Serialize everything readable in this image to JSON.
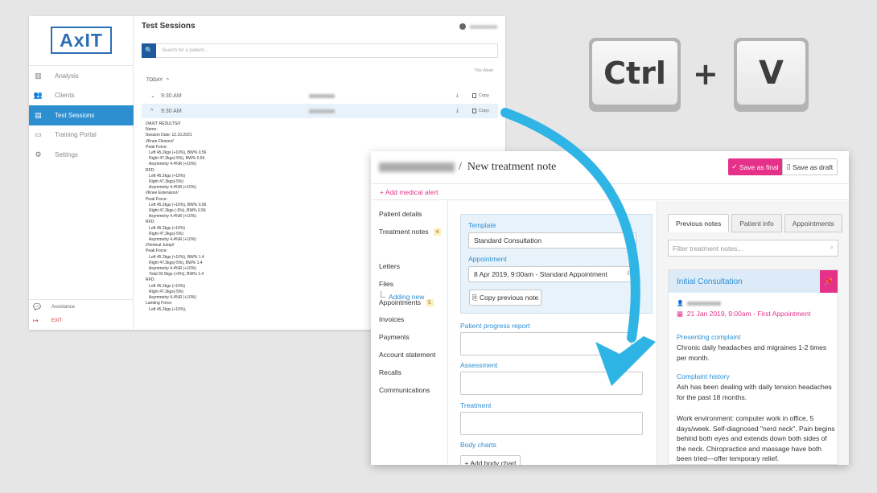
{
  "axit": {
    "logo": "AxIT",
    "nav": [
      {
        "label": "Analysis",
        "icon": "bar-chart-icon"
      },
      {
        "label": "Clients",
        "icon": "users-icon"
      },
      {
        "label": "Test Sessions",
        "icon": "document-icon",
        "active": true
      },
      {
        "label": "Training Portal",
        "icon": "monitor-icon"
      },
      {
        "label": "Settings",
        "icon": "gear-icon"
      }
    ],
    "assistance": "Assistance",
    "exit": "EXIT",
    "title": "Test Sessions",
    "search_placeholder": "Search for a patient...",
    "this_week": "This Week",
    "today": "TODAY",
    "sessions": [
      {
        "time": "9:30 AM",
        "copy": "Copy"
      },
      {
        "time": "9:30 AM",
        "copy": "Copy"
      }
    ],
    "results_text": "///AXIT RESULTS///\nName:\nSession Date: 12.10.2021\n//Knee Flexion//\nPeak Force:\n   Left 45.2kgs (+10%), BW% 0.56\n   Right 47.3kgs(-5%), BW% 0.56\n   Asymmetry 4.4%R (+10%)\nRFD:\n   Left 45.2kgs (+10%)\n   Right 47.3kgs(-5%)\n   Asymmetry 4.4%R (+10%)\n//Knee Extension//\nPeak Force:\n   Left 45.2kgs (+10%), BW% 0.56\n   Right 47.3kgs (-5%), BW% 0.56\n   Asymmetry 4.4%R (+10%)\nRFD:\n   Left 45.2kgs (+10%)\n   Right 47.3kgs(-5%)\n   Asymmetry 4.4%R (+10%)\n//Vertical Jump//\nPeak Force:\n   Left 45.2kgs (+10%), BW% 1.4\n   Right 47.3kgs(-5%), BW% 1.4\n   Asymmetry 4.4%R (+10%)\n   Total 92.5kgs (+5%), BW% 1.4\nRFD:\n   Left 45.2kgs (+10%)\n   Right 47.3kgs(-5%)\n   Asymmetry 4.4%R (+10%)\nLanding Force:\n   Left 45.2kgs (+10%),"
  },
  "keys": {
    "ctrl": "Ctrl",
    "plus": "+",
    "v": "V"
  },
  "note": {
    "separator": "/",
    "title": "New treatment note",
    "save_final": "Save as final",
    "save_draft": "Save as draft",
    "add_alert": "+ Add medical alert",
    "sidebar": [
      {
        "label": "Patient details"
      },
      {
        "label": "Treatment notes",
        "count": "4"
      },
      {
        "label": "Letters"
      },
      {
        "label": "Files"
      },
      {
        "label": "Appointments",
        "count": "5"
      },
      {
        "label": "Invoices"
      },
      {
        "label": "Payments"
      },
      {
        "label": "Account statement"
      },
      {
        "label": "Recalls"
      },
      {
        "label": "Communications"
      }
    ],
    "adding_new": "Adding new",
    "template_label": "Template",
    "template_value": "Standard Consultation",
    "appointment_label": "Appointment",
    "appointment_value": "8 Apr 2019, 9:00am - Standard Appointment",
    "copy_previous": "Copy previous note",
    "progress_label": "Patient progress report",
    "assessment_label": "Assessment",
    "treatment_label": "Treatment",
    "body_charts_label": "Body charts",
    "add_body_chart": "+ Add body chart",
    "tabs": [
      "Previous notes",
      "Patient info",
      "Appointments"
    ],
    "filter_placeholder": "Filter treatment notes...",
    "consult_title": "Initial Consultation",
    "consult_date": "21 Jan 2019, 9:00am - First Appointment",
    "presenting_title": "Presenting complaint",
    "presenting_text": "Chronic daily headaches and migraines 1-2 times per month.",
    "history_title": "Complaint history",
    "history_text": "Ash has been dealing with daily tension headaches for the past 18 months.",
    "work_text": "Work environment: computer work in office, 5 days/week. Self-diagnosed \"nerd neck\". Pain begins behind both eyes and extends down both sides of the neck. Chiropractice and massage have both been tried—offer temporary relief."
  },
  "colors": {
    "axit_blue": "#2d8fd0",
    "pink": "#e5318a",
    "arrow": "#2fb4e6"
  }
}
